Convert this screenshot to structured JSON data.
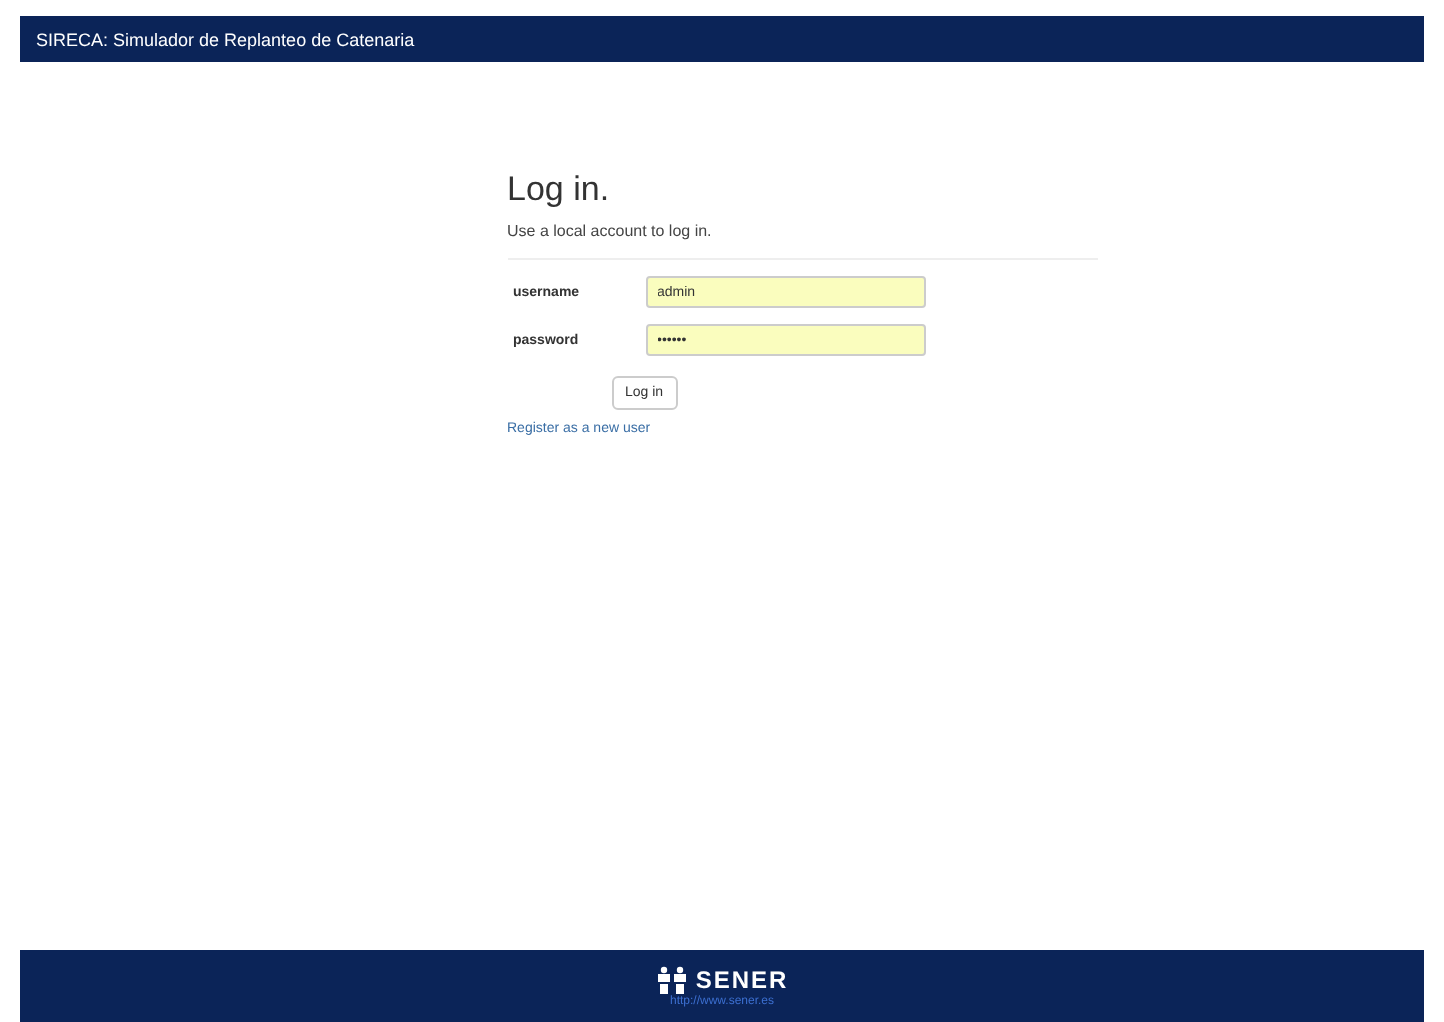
{
  "header": {
    "title": "SIRECA: Simulador de Replanteo de Catenaria"
  },
  "login": {
    "heading": "Log in.",
    "subtitle": "Use a local account to log in.",
    "fields": [
      {
        "label": "username",
        "value": "admin"
      },
      {
        "label": "password",
        "value": "••••••"
      }
    ],
    "button": "Log in",
    "register_link": "Register as a new user"
  },
  "footer": {
    "logo_text": "SENER",
    "url": "http://www.sener.es"
  }
}
